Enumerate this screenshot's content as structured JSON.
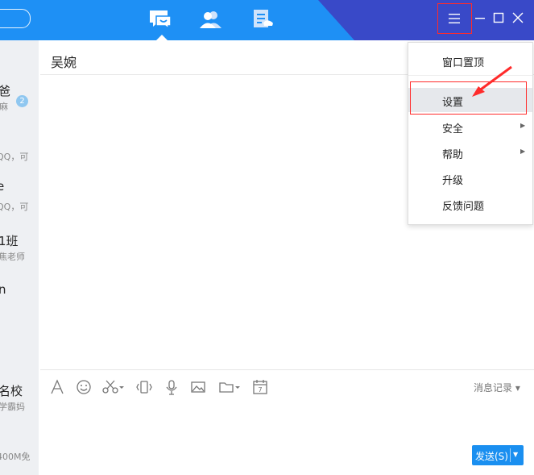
{
  "contact_title": "吴婉",
  "sidebar": {
    "items": [
      {
        "name": "爸",
        "sub": "麻",
        "badge": "2"
      },
      {
        "name": "",
        "sub": "QQ，可"
      },
      {
        "name": "e",
        "sub": "QQ，可"
      },
      {
        "name": "1班",
        "sub": "焦老师"
      },
      {
        "name": "n",
        "sub": ""
      },
      {
        "name": "名校",
        "sub": "学霸妈"
      },
      {
        "name": "",
        "sub": "400M免"
      }
    ]
  },
  "menu": {
    "items": [
      {
        "label": "窗口置顶",
        "submenu": false
      },
      {
        "label": "设置",
        "submenu": false,
        "highlighted": true
      },
      {
        "label": "安全",
        "submenu": true
      },
      {
        "label": "帮助",
        "submenu": true
      },
      {
        "label": "升级",
        "submenu": false
      },
      {
        "label": "反馈问题",
        "submenu": false
      }
    ]
  },
  "toolbar": {
    "icons": [
      "font-icon",
      "emoji-icon",
      "scissors-icon",
      "shake-icon",
      "microphone-icon",
      "image-icon",
      "folder-icon",
      "calendar-icon"
    ],
    "calendar_day": "7",
    "history_label": "消息记录 ▾"
  },
  "send_button": {
    "label": "发送(S)",
    "caret": "▼"
  },
  "colors": {
    "topbar": "#1e90f5",
    "topbar_wedge": "#3949c8",
    "accent_send": "#1a8ff0",
    "annotation_red": "#ff2b2b"
  }
}
